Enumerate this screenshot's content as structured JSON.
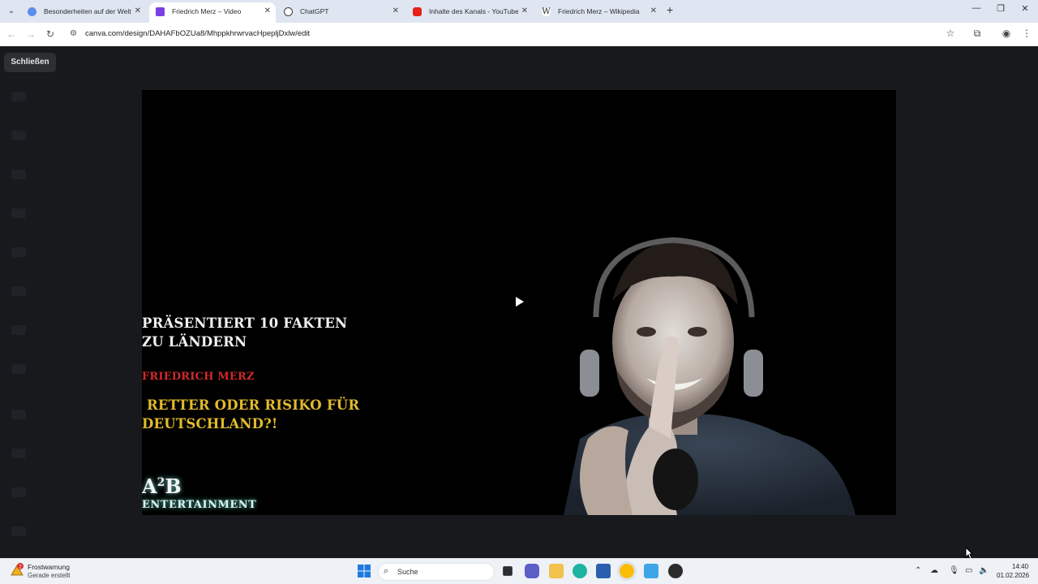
{
  "browser": {
    "tabs": [
      {
        "title": "Besonderheiten auf der Welt – ",
        "favicon_color": "#5b8def",
        "active": false
      },
      {
        "title": "Friedrich Merz – Video",
        "favicon_color": "#7b3fe4",
        "active": true
      },
      {
        "title": "ChatGPT",
        "favicon_color": "#3b3b3b",
        "active": false
      },
      {
        "title": "Inhalte des Kanals - YouTube St",
        "favicon_color": "#e62117",
        "active": false
      },
      {
        "title": "Friedrich Merz – Wikipedia",
        "favicon_color": "#2b2b2b",
        "active": false
      }
    ],
    "close_glyph": "✕",
    "new_tab_glyph": "+",
    "url": "canva.com/design/DAHAFbOZUa8/MhppkhrwrvacHpepljDxlw/edit"
  },
  "app": {
    "close_label": "Schließen",
    "video": {
      "line1": [
        "PRÄSENTIERT 10 FAKTEN",
        "ZU LÄNDERN"
      ],
      "line2": "FRIEDRICH MERZ",
      "line3": [
        " RETTER ODER RISIKO FÜR",
        "DEUTSCHLAND?!"
      ],
      "logo_main_a": "A",
      "logo_main_sup": "2",
      "logo_main_b": "B",
      "logo_sub": "ENTERTAINMENT"
    }
  },
  "taskbar": {
    "weather_title": "Frostwarnung",
    "weather_sub": "Gerade erstellt",
    "weather_badge": "2",
    "search_placeholder": "Suche",
    "time": "14:40",
    "date": "01.02.2026"
  },
  "colors": {
    "title_white": "#f1f1f1",
    "name_red": "#d02a2a",
    "question_gold": "#e1bb2c",
    "logo_glow": "#8cfff0"
  }
}
